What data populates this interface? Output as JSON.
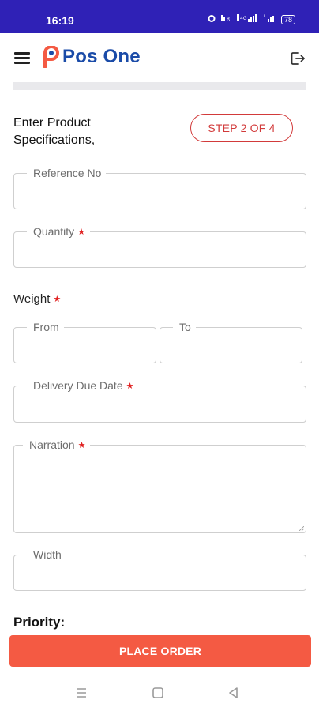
{
  "status_bar": {
    "time": "16:19",
    "icons": [
      "alarm-icon",
      "volte-icon",
      "wifi-signal-icon",
      "cell-signal-icon",
      "battery-icon"
    ],
    "battery": "78"
  },
  "header": {
    "app_name": "Pos One",
    "menu_icon": "hamburger-menu-icon",
    "logout_icon": "logout-icon",
    "brand_colors": {
      "primary": "#1a4ba8",
      "accent": "#f45a43"
    }
  },
  "form": {
    "title": "Enter Product Specifications,",
    "step": "STEP 2 OF 4",
    "fields": {
      "reference_no": {
        "label": "Reference No",
        "value": ""
      },
      "quantity": {
        "label": "Quantity",
        "required_mark": "★",
        "value": ""
      },
      "weight": {
        "label": "Weight",
        "required_mark": "★",
        "from_label": "From",
        "to_label": "To"
      },
      "delivery_due_date": {
        "label": "Delivery Due Date",
        "required_mark": "★",
        "value": ""
      },
      "narration": {
        "label": "Narration",
        "required_mark": "★",
        "value": ""
      },
      "width": {
        "label": "Width",
        "value": ""
      }
    },
    "priority_label": "Priority:",
    "submit_label": "PLACE ORDER"
  },
  "nav": {
    "recent": "recent-apps-icon",
    "home": "home-icon",
    "back": "back-icon"
  },
  "colors": {
    "status_bar": "#2f21b6",
    "step_badge": "#d23a3a",
    "required": "#e02020",
    "button": "#f45a43"
  }
}
